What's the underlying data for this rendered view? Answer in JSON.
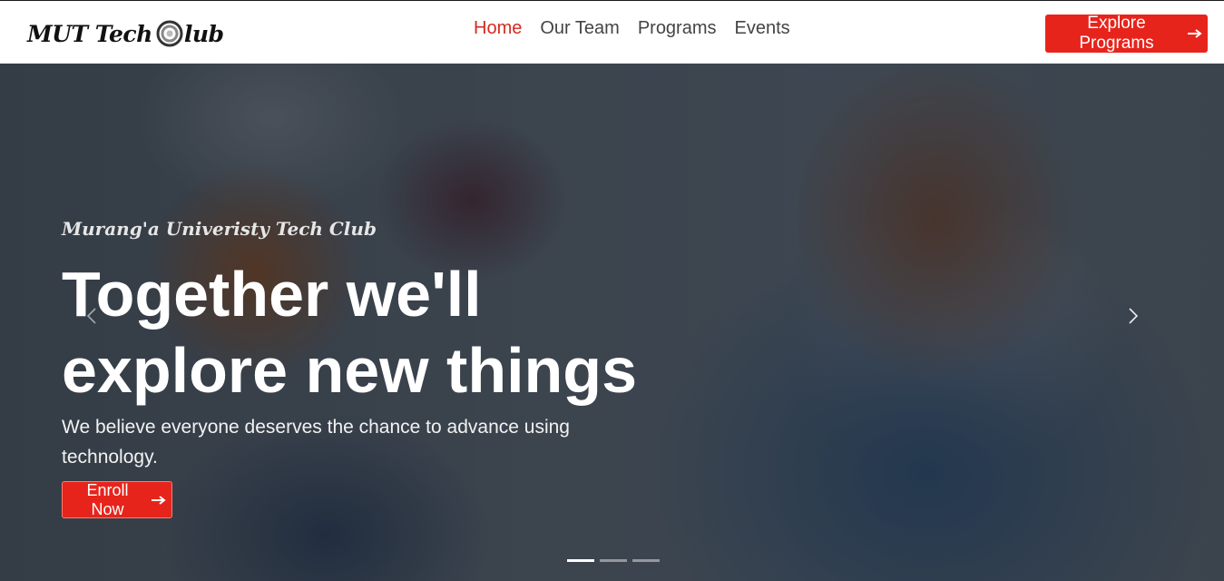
{
  "brand": {
    "logo_text_left": "MUT Tech",
    "logo_text_right": "lub"
  },
  "nav": {
    "items": [
      {
        "label": "Home",
        "active": true
      },
      {
        "label": "Our Team",
        "active": false
      },
      {
        "label": "Programs",
        "active": false
      },
      {
        "label": "Events",
        "active": false
      }
    ],
    "cta_label": "Explore Programs",
    "cta_icon": "arrow-right-icon"
  },
  "hero": {
    "kicker": "Murang'a Univeristy Tech Club",
    "headline_line1": "Together we'll",
    "headline_line2": "explore new things",
    "lede": "We believe everyone deserves the chance to advance using technology.",
    "enroll_label": "Enroll Now",
    "enroll_icon": "arrow-right-icon"
  },
  "carousel": {
    "prev_icon": "chevron-left-icon",
    "next_icon": "chevron-right-icon",
    "slide_count": 3,
    "active_slide": 1
  },
  "colors": {
    "accent": "#e7241b",
    "nav_active": "#d52b1e",
    "nav_text": "#444444",
    "header_bg": "#ffffff",
    "hero_text": "#ffffff"
  }
}
